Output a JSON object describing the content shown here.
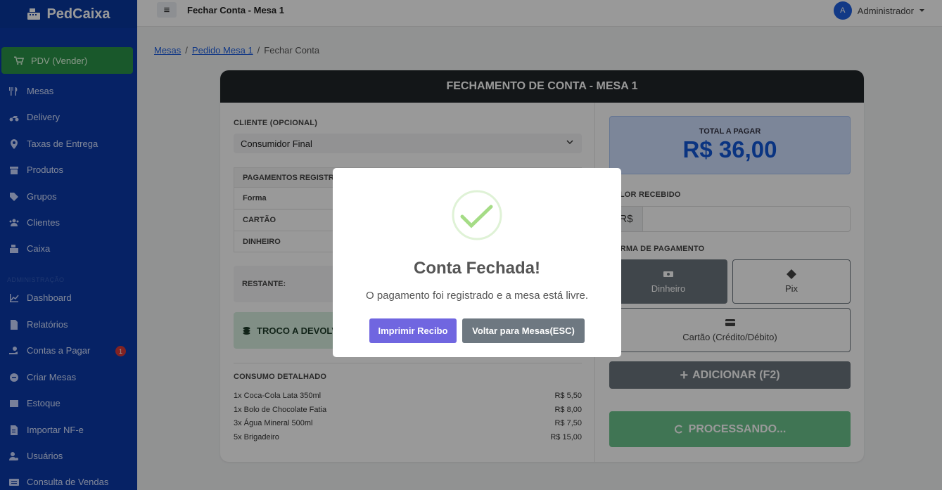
{
  "sidebar": {
    "brand": "PedCaixa",
    "pdv_label": "PDV (Vender)",
    "items": [
      {
        "label": "Mesas",
        "icon": "utensils-icon"
      },
      {
        "label": "Delivery",
        "icon": "motorcycle-icon"
      },
      {
        "label": "Taxas de Entrega",
        "icon": "map-pin-icon"
      },
      {
        "label": "Produtos",
        "icon": "box-icon"
      },
      {
        "label": "Grupos",
        "icon": "tags-icon"
      },
      {
        "label": "Clientes",
        "icon": "users-icon"
      },
      {
        "label": "Caixa",
        "icon": "cash-register-icon"
      }
    ],
    "section_label": "ADMINISTRAÇÃO",
    "admin_items": [
      {
        "label": "Dashboard",
        "icon": "chart-line-icon"
      },
      {
        "label": "Relatórios",
        "icon": "file-icon"
      },
      {
        "label": "Contas a Pagar",
        "icon": "hand-money-icon",
        "badge": "1"
      },
      {
        "label": "Criar Mesas",
        "icon": "plus-circle-icon"
      },
      {
        "label": "Estoque",
        "icon": "warehouse-icon"
      },
      {
        "label": "Importar NF-e",
        "icon": "file-import-icon"
      },
      {
        "label": "Usuários",
        "icon": "user-cog-icon"
      },
      {
        "label": "Consulta de Vendas",
        "icon": "list-icon"
      }
    ]
  },
  "topbar": {
    "menu_glyph": "≡",
    "title": "Fechar Conta - Mesa 1",
    "avatar_letter": "A",
    "user_name": "Administrador"
  },
  "breadcrumb": {
    "items": [
      "Mesas",
      "Pedido Mesa 1",
      "Fechar Conta"
    ],
    "separator": "/"
  },
  "card": {
    "title": "FECHAMENTO DE CONTA - MESA 1",
    "client_label": "CLIENTE (OPCIONAL)",
    "client_value": "Consumidor Final",
    "payments_title": "PAGAMENTOS REGISTRADOS",
    "payments_header": "Forma",
    "payments_rows": [
      "CARTÃO",
      "DINHEIRO"
    ],
    "remaining_label": "RESTANTE:",
    "troco_label": "TROCO A DEVOLVER",
    "consumo_title": "CONSUMO DETALHADO",
    "consumo_items": [
      {
        "desc": "1x Coca-Cola Lata 350ml",
        "price": "R$ 5,50"
      },
      {
        "desc": "1x Bolo de Chocolate Fatia",
        "price": "R$ 8,00"
      },
      {
        "desc": "3x Água Mineral 500ml",
        "price": "R$ 7,50"
      },
      {
        "desc": "5x Brigadeiro",
        "price": "R$ 15,00"
      }
    ],
    "total_label": "TOTAL A PAGAR",
    "total_value": "R$ 36,00",
    "valor_recebido_label": "VALOR RECEBIDO",
    "currency_prefix": "R$",
    "forma_pagamento_label": "FORMA DE PAGAMENTO",
    "pay_dinheiro": "Dinheiro",
    "pay_pix": "Pix",
    "pay_cartao": "Cartão (Crédito/Débito)",
    "add_button": "ADICIONAR (F2)",
    "process_button": "PROCESSANDO..."
  },
  "modal": {
    "title": "Conta Fechada!",
    "text": "O pagamento foi registrado e a mesa está livre.",
    "print_button": "Imprimir Recibo",
    "back_button": "Voltar para Mesas(ESC)"
  },
  "colors": {
    "sidebar": "#0a3aa8",
    "pdv": "#2b9348",
    "total": "#1257d8",
    "print_button": "#7066e0",
    "back_button": "#6e7881",
    "check": "#a5dc86"
  }
}
